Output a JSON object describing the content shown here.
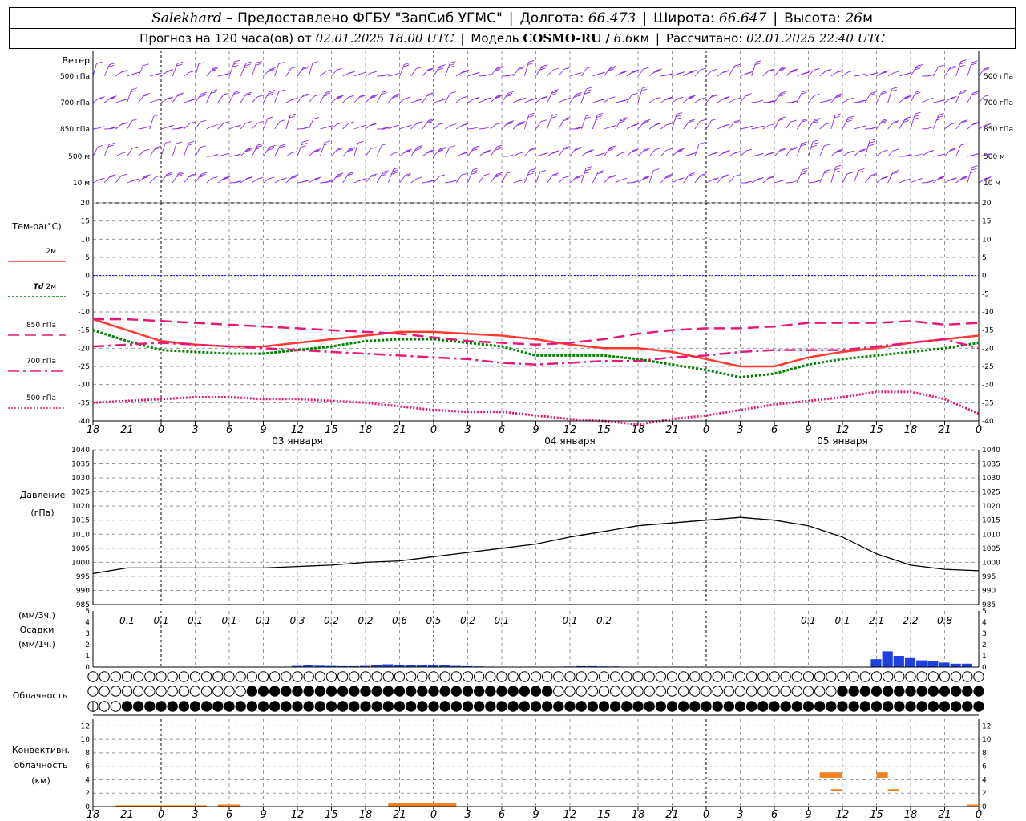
{
  "header": {
    "station": "Salekhard",
    "provided": "– Предоставлено ФГБУ \"ЗапСиб УГМС\"",
    "lon_label": "Долгота:",
    "lon_value": "66.473",
    "lat_label": "Широта:",
    "lat_value": "66.647",
    "alt_label": "Высота:",
    "alt_value": "26",
    "alt_unit": "м",
    "forecast_prefix": "Прогноз на 120 часа(ов) от",
    "forecast_time": "02.01.2025 18:00 UTC",
    "model_label": "Модель",
    "model_name": "COSMO-RU /",
    "model_res": "6.6",
    "model_res_unit": "км",
    "computed_label": "Рассчитано:",
    "computed_time": "02.01.2025 22:40 UTC"
  },
  "colors": {
    "wind": "#8a2be2",
    "t2m": "#ff3b30",
    "td2m": "#008000",
    "t850": "#e8187a",
    "t700": "#e8187a",
    "t500": "#e8187a",
    "zero_line": "#0000ff",
    "pressure": "#000000",
    "precip": "#1f3fe0",
    "convective": "#f08020",
    "grid": "#9a9a9a"
  },
  "chart_data": [
    {
      "type": "wind_barbs",
      "panel_label": "Ветер",
      "levels": [
        "500 гПа",
        "700 гПа",
        "850 гПа",
        "500 м",
        "10 м"
      ]
    },
    {
      "type": "line",
      "panel_label": "Тем-ра(°C)",
      "ylim": [
        -40,
        20
      ],
      "yticks": [
        20,
        15,
        10,
        5,
        0,
        -5,
        -10,
        -15,
        -20,
        -25,
        -30,
        -35,
        -40
      ],
      "x_ticks": [
        "18",
        "21",
        "0",
        "3",
        "6",
        "9",
        "12",
        "15",
        "18",
        "21",
        "0",
        "3",
        "6",
        "9",
        "12",
        "15",
        "18",
        "21",
        "0",
        "3",
        "6",
        "9",
        "12",
        "15",
        "18",
        "21",
        "0"
      ],
      "day_labels": [
        {
          "hour": 18,
          "label": "03 января"
        },
        {
          "hour": 42,
          "label": "04 января"
        },
        {
          "hour": 66,
          "label": "05 января"
        }
      ],
      "series": [
        {
          "name": "2м",
          "style": "solid",
          "x": [
            0,
            3,
            6,
            9,
            12,
            15,
            18,
            21,
            24,
            27,
            30,
            33,
            36,
            39,
            42,
            45,
            48,
            51,
            54,
            57,
            60,
            63,
            66,
            69,
            72,
            75,
            78
          ],
          "values": [
            -12,
            -15,
            -18,
            -19,
            -19.5,
            -19.5,
            -18.5,
            -17.5,
            -16.5,
            -15.5,
            -15.5,
            -16,
            -16.5,
            -17.5,
            -19,
            -20,
            -20,
            -21,
            -23,
            -25,
            -25,
            -22.5,
            -21,
            -20,
            -18.5,
            -17.5,
            -16.5
          ]
        },
        {
          "name": "Td 2м",
          "style": "dotted",
          "x": [
            0,
            3,
            6,
            9,
            12,
            15,
            18,
            21,
            24,
            27,
            30,
            33,
            36,
            39,
            42,
            45,
            48,
            51,
            54,
            57,
            60,
            63,
            66,
            69,
            72,
            75,
            78
          ],
          "values": [
            -15,
            -18,
            -20.5,
            -21,
            -21.5,
            -21.5,
            -20.5,
            -19.5,
            -18,
            -17.5,
            -17.5,
            -18.5,
            -19.5,
            -22,
            -22,
            -22,
            -23,
            -24.5,
            -26,
            -28,
            -27,
            -24.5,
            -23,
            -22,
            -21,
            -20,
            -18.5
          ]
        },
        {
          "name": "850 гПа",
          "style": "dashed",
          "x": [
            0,
            3,
            6,
            9,
            12,
            15,
            18,
            21,
            24,
            27,
            30,
            33,
            36,
            39,
            42,
            45,
            48,
            51,
            54,
            57,
            60,
            63,
            66,
            69,
            72,
            75,
            78
          ],
          "values": [
            -12,
            -12,
            -12.5,
            -13,
            -13.5,
            -14,
            -14.5,
            -15,
            -15.5,
            -16,
            -17,
            -18,
            -18.5,
            -19,
            -18.5,
            -17.5,
            -16,
            -15,
            -14.5,
            -14.5,
            -14,
            -13,
            -13,
            -13,
            -12.5,
            -13.5,
            -13
          ]
        },
        {
          "name": "700 гПа",
          "style": "dashdot",
          "x": [
            0,
            3,
            6,
            9,
            12,
            15,
            18,
            21,
            24,
            27,
            30,
            33,
            36,
            39,
            42,
            45,
            48,
            51,
            54,
            57,
            60,
            63,
            66,
            69,
            72,
            75,
            78
          ],
          "values": [
            -19.5,
            -19,
            -18.5,
            -19,
            -19.5,
            -20,
            -20.5,
            -21,
            -21.5,
            -22,
            -22.5,
            -23,
            -24,
            -24.5,
            -24,
            -23.5,
            -23.5,
            -22.5,
            -22,
            -21,
            -20.5,
            -20.5,
            -20.5,
            -19.5,
            -18.5,
            -17.5,
            -20
          ]
        },
        {
          "name": "500 гПа",
          "style": "dotted",
          "x": [
            0,
            3,
            6,
            9,
            12,
            15,
            18,
            21,
            24,
            27,
            30,
            33,
            36,
            39,
            42,
            45,
            48,
            51,
            54,
            57,
            60,
            63,
            66,
            69,
            72,
            75,
            78
          ],
          "values": [
            -35,
            -34.5,
            -34,
            -33.5,
            -33.5,
            -34,
            -34,
            -34.5,
            -35,
            -36,
            -37,
            -37.5,
            -37.5,
            -38.5,
            -39.5,
            -40,
            -41,
            -39.5,
            -38.5,
            -37,
            -35.5,
            -34.5,
            -33.5,
            -32,
            -32,
            -34,
            -38
          ]
        }
      ]
    },
    {
      "type": "line",
      "panel_label": "Давление",
      "ylabel": "(гПа)",
      "ylim": [
        985,
        1040
      ],
      "yticks": [
        1040,
        1035,
        1030,
        1025,
        1020,
        1015,
        1010,
        1005,
        1000,
        995,
        990,
        985
      ],
      "series": [
        {
          "name": "",
          "x": [
            0,
            3,
            6,
            9,
            12,
            15,
            18,
            21,
            24,
            27,
            30,
            33,
            36,
            39,
            42,
            45,
            48,
            51,
            54,
            57,
            60,
            63,
            66,
            69,
            72,
            75,
            78
          ],
          "values": [
            996,
            998,
            998,
            998,
            998,
            998,
            998.5,
            999,
            1000,
            1000.5,
            1002,
            1003.5,
            1005,
            1006.5,
            1009,
            1011,
            1013,
            1014,
            1015,
            1016,
            1015,
            1013,
            1009,
            1003,
            999,
            997.5,
            997
          ]
        }
      ]
    },
    {
      "type": "bar",
      "panel_label": "Осадки",
      "ylabel_top": "(мм/3ч.)",
      "ylabel_bottom": "(мм/1ч.)",
      "ylim": [
        0,
        5
      ],
      "yticks": [
        5,
        4,
        3,
        2,
        1,
        0
      ],
      "labels_3h": [
        {
          "hour": 3,
          "text": "0.1"
        },
        {
          "hour": 6,
          "text": "0.1"
        },
        {
          "hour": 9,
          "text": "0.1"
        },
        {
          "hour": 12,
          "text": "0.1"
        },
        {
          "hour": 15,
          "text": "0.1"
        },
        {
          "hour": 18,
          "text": "0.3"
        },
        {
          "hour": 21,
          "text": "0.2"
        },
        {
          "hour": 24,
          "text": "0.2"
        },
        {
          "hour": 27,
          "text": "0.6"
        },
        {
          "hour": 30,
          "text": "0.5"
        },
        {
          "hour": 33,
          "text": "0.2"
        },
        {
          "hour": 36,
          "text": "0.1"
        },
        {
          "hour": 42,
          "text": "0.1"
        },
        {
          "hour": 45,
          "text": "0.2"
        },
        {
          "hour": 63,
          "text": "0.1"
        },
        {
          "hour": 66,
          "text": "0.1"
        },
        {
          "hour": 69,
          "text": "2.1"
        },
        {
          "hour": 72,
          "text": "2.2"
        },
        {
          "hour": 75,
          "text": "0.8"
        }
      ],
      "hourly_x": [
        18,
        19,
        20,
        21,
        22,
        23,
        24,
        25,
        26,
        27,
        28,
        29,
        30,
        31,
        32,
        33,
        34,
        35,
        42,
        43,
        44,
        45,
        46,
        69,
        70,
        71,
        72,
        73,
        74,
        75,
        76,
        77
      ],
      "hourly_values": [
        0.1,
        0.15,
        0.12,
        0.1,
        0.08,
        0.08,
        0.1,
        0.2,
        0.25,
        0.2,
        0.2,
        0.2,
        0.18,
        0.15,
        0.1,
        0.08,
        0.06,
        0.04,
        0.05,
        0.08,
        0.08,
        0.06,
        0.05,
        0.7,
        1.4,
        1.0,
        0.8,
        0.6,
        0.5,
        0.4,
        0.3,
        0.3
      ]
    },
    {
      "type": "cloud_symbols",
      "panel_label": "Облачность",
      "rows": [
        {
          "level": "upper",
          "codes": "000000000000000000000000000000000000000000000000000000000000000000000000000000000000000000000000000000000000000000000000000000000000000000000000000000000000000000000000000000000000000000000000000000000000000000000000000000000000000000000000000000000"
        },
        {
          "level": "middle",
          "codes": "0000000000000000000000000000000044444444444444444444444444444444444444444444444444444444444444440000000000000000000000000000000000000000000000000000000000004444444444444444444444444444444"
        },
        {
          "level": "low",
          "codes": "1000000444444444444444444444444444444444444444444444444444444444444444444444444444444444444444444444444444444444444444444444444444444444444444444444444444444444444444444444444444444444444"
        }
      ]
    },
    {
      "type": "bar",
      "panel_label": "Конвективн. облачность",
      "ylabel": "(км)",
      "ylim": [
        0,
        13
      ],
      "yticks": [
        12,
        10,
        8,
        6,
        4,
        2,
        0
      ],
      "segments": [
        {
          "x0": 2,
          "x1": 10,
          "bottom": 0,
          "top": 0.2
        },
        {
          "x0": 11,
          "x1": 13,
          "bottom": 0,
          "top": 0.3
        },
        {
          "x0": 26,
          "x1": 32,
          "bottom": 0,
          "top": 0.5
        },
        {
          "x0": 64,
          "x1": 66,
          "bottom": 4.3,
          "top": 5.1
        },
        {
          "x0": 65,
          "x1": 66,
          "bottom": 2.3,
          "top": 2.6
        },
        {
          "x0": 69,
          "x1": 70,
          "bottom": 4.3,
          "top": 5.1
        },
        {
          "x0": 70,
          "x1": 71,
          "bottom": 2.3,
          "top": 2.6
        },
        {
          "x0": 77,
          "x1": 78,
          "bottom": 0.1,
          "top": 0.3
        }
      ]
    }
  ]
}
